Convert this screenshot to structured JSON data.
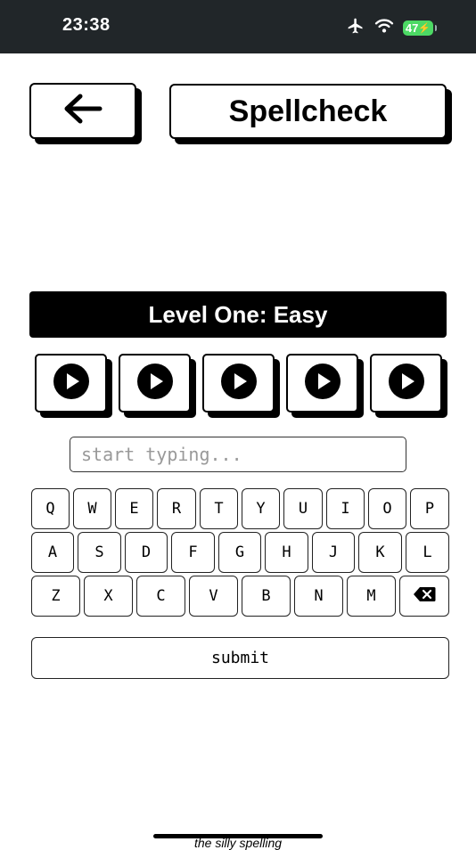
{
  "status": {
    "time": "23:38",
    "battery": "47",
    "icons": [
      "airplane-icon",
      "wifi-icon",
      "battery-icon"
    ]
  },
  "header": {
    "back_icon": "arrow-left-icon",
    "title": "Spellcheck"
  },
  "level": {
    "label": "Level One: Easy"
  },
  "play_buttons": [
    {
      "icon": "play-icon"
    },
    {
      "icon": "play-icon"
    },
    {
      "icon": "play-icon"
    },
    {
      "icon": "play-icon"
    },
    {
      "icon": "play-icon"
    }
  ],
  "input": {
    "placeholder": "start typing...",
    "value": ""
  },
  "keyboard": {
    "row1": [
      "Q",
      "W",
      "E",
      "R",
      "T",
      "Y",
      "U",
      "I",
      "O",
      "P"
    ],
    "row2": [
      "A",
      "S",
      "D",
      "F",
      "G",
      "H",
      "J",
      "K",
      "L"
    ],
    "row3": [
      "Z",
      "X",
      "C",
      "V",
      "B",
      "N",
      "M"
    ],
    "backspace_icon": "backspace-icon"
  },
  "submit": {
    "label": "submit"
  },
  "footer": {
    "text": "the silly spelling"
  },
  "colors": {
    "statusbar": "#212629",
    "accent": "#000000",
    "battery": "#4cd964"
  }
}
